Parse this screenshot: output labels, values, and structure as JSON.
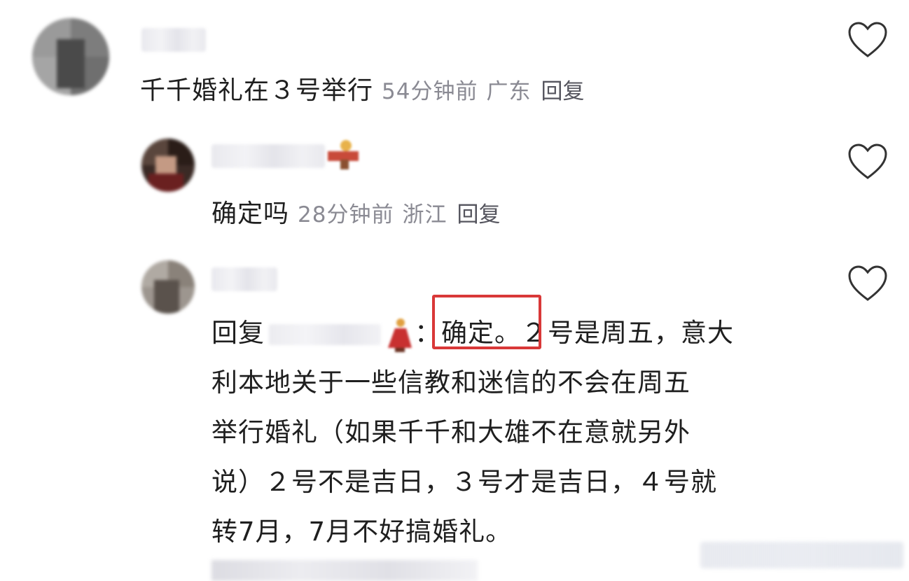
{
  "comments": [
    {
      "text": "千千婚礼在３号举行",
      "time": "54分钟前",
      "location": "广东",
      "reply_label": "回复"
    },
    {
      "text": "确定吗",
      "time": "28分钟前",
      "location": "浙江",
      "reply_label": "回复"
    },
    {
      "reply_prefix": "回复",
      "highlight": "：确定。",
      "body_line1": "２号是周五，意大",
      "body_line2": "利本地关于一些信教和迷信的不会在周五",
      "body_line3": "举行婚礼（如果千千和大雄不在意就另外",
      "body_line4": "说）２号不是吉日，３号才是吉日，４号就",
      "body_line5": "转7月，7月不好搞婚礼。"
    }
  ],
  "icons": {
    "like": "heart-outline-icon"
  },
  "colors": {
    "highlight_box": "#d93838",
    "meta_text": "#8a8a93"
  }
}
